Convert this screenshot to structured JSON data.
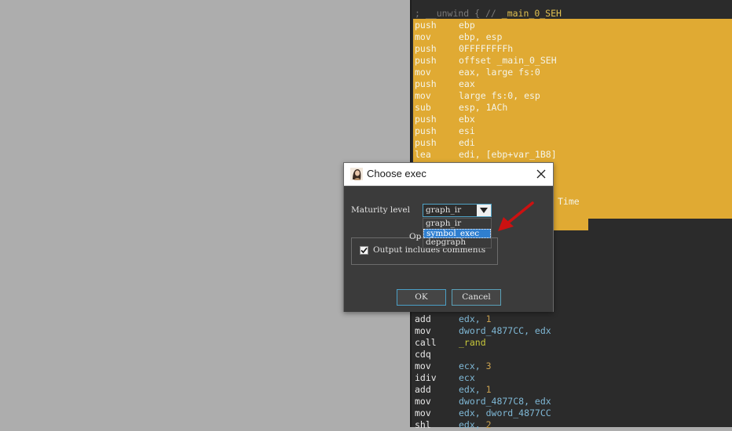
{
  "disasm": {
    "top_comment": "; __unwind { // ",
    "top_seh": "_main_0_SEH",
    "highlighted_lines": [
      {
        "mn": "push",
        "op": "ebp"
      },
      {
        "mn": "mov",
        "op": "ebp, esp"
      },
      {
        "mn": "push",
        "op": "0FFFFFFFFh"
      },
      {
        "mn": "push",
        "op": "offset _main_0_SEH"
      },
      {
        "mn": "mov",
        "op": "eax, large fs:0"
      },
      {
        "mn": "push",
        "op": "eax"
      },
      {
        "mn": "mov",
        "op": "large fs:0, esp"
      },
      {
        "mn": "sub",
        "op": "esp, 1ACh"
      },
      {
        "mn": "push",
        "op": "ebx"
      },
      {
        "mn": "push",
        "op": "esi"
      },
      {
        "mn": "push",
        "op": "edi"
      },
      {
        "mn": "lea",
        "op": "edi, [ebp+var_1B8]"
      }
    ],
    "partial_time": "Time",
    "dark_lines": [
      {
        "mn": "add",
        "op": "edx, ",
        "num": "1"
      },
      {
        "mn": "mov",
        "op": "dword_4877CC, edx"
      },
      {
        "mn": "call",
        "fn": "_rand"
      },
      {
        "mn": "cdq",
        "op": ""
      },
      {
        "mn": "mov",
        "op": "ecx, ",
        "num": "3"
      },
      {
        "mn": "idiv",
        "op": "ecx"
      },
      {
        "mn": "add",
        "op": "edx, ",
        "num": "1"
      },
      {
        "mn": "mov",
        "op": "dword_4877C8, edx"
      },
      {
        "mn": "mov",
        "op": "edx, dword_4877CC"
      },
      {
        "mn": "shl",
        "op": "edx, ",
        "num": "2"
      }
    ]
  },
  "dialog": {
    "title": "Choose exec",
    "maturity_label": "Maturity level",
    "selected_value": "graph_ir",
    "options": [
      "graph_ir",
      "symbol_exec",
      "depgraph"
    ],
    "highlighted_option_index": 1,
    "options_group_title": "Op",
    "checkbox_label": "Output includes comments",
    "checkbox_checked": true,
    "ok_label": "OK",
    "cancel_label": "Cancel"
  },
  "annotation_arrow_color": "#cc1111",
  "highlight_color": "#e0aa33"
}
